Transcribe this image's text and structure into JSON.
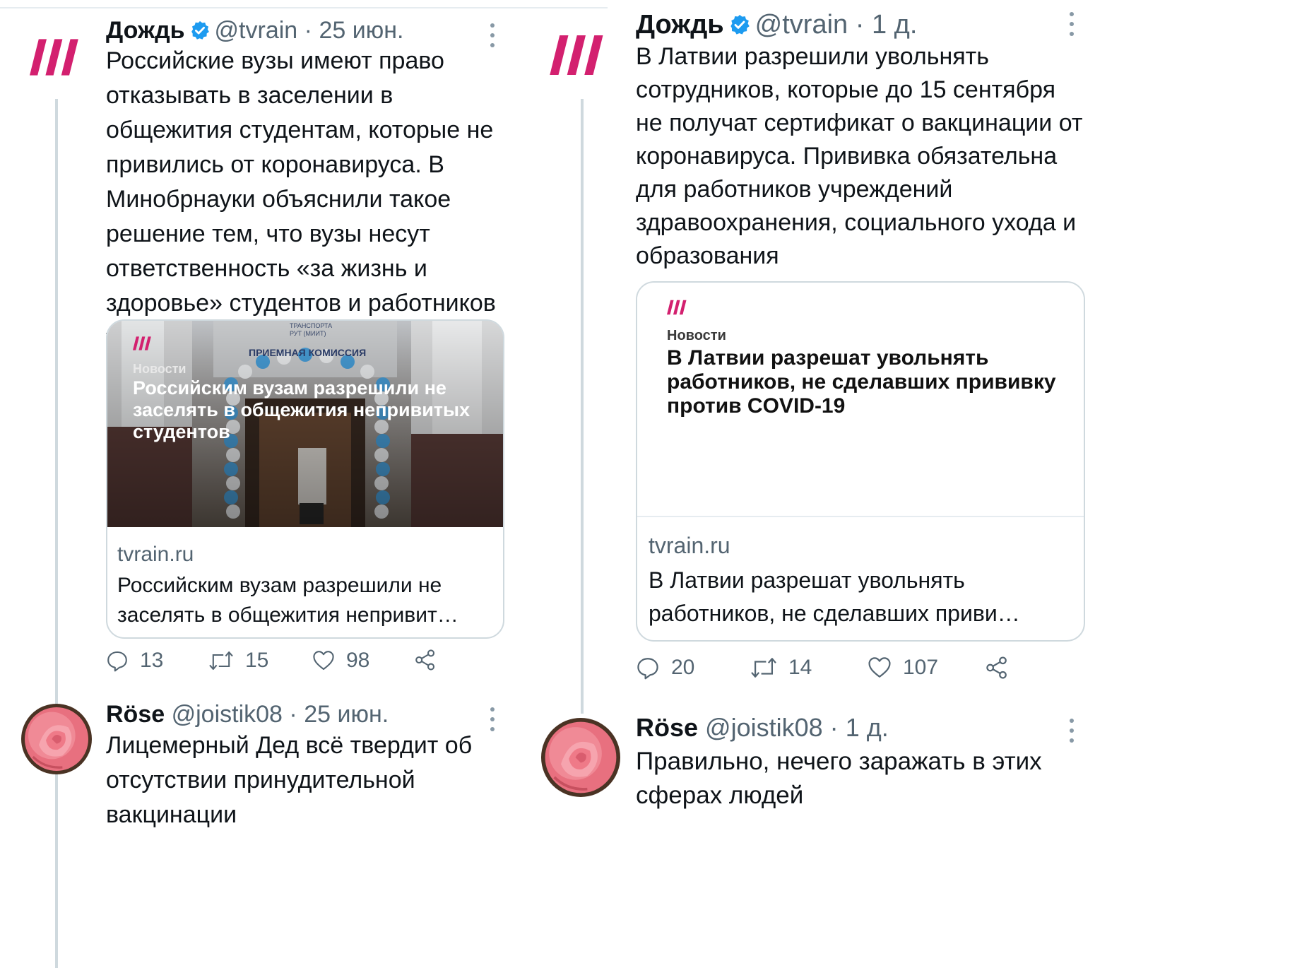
{
  "colors": {
    "brand": "#d3206f",
    "verified": "#1d9bf0",
    "muted": "#536471",
    "text": "#0f1419",
    "border": "#cfd9de"
  },
  "left": {
    "tweet": {
      "name": "Дождь",
      "handle": "@tvrain",
      "sep": "·",
      "date": "25 июн.",
      "text": "Российские вузы имеют право отказывать в заселении в общежития студентам, которые не привились от коронавируса. В Минобрнауки объяснили такое решение тем, что вузы несут ответственность «за жизнь и здоровье» студентов и работников учреждения",
      "card": {
        "media_label": "Новости",
        "media_title": "Российским вузам разрешили не заселять в общежития непривитых студентов",
        "sign_line1": "ТРАНСПОРТА",
        "sign_line2": "РУТ (МИИТ)",
        "sign_main": "ПРИЕМНАЯ КОМИССИЯ",
        "domain": "tvrain.ru",
        "title": "Российским вузам разрешили не заселять в общежития непривит…"
      },
      "replies": "13",
      "retweets": "15",
      "likes": "98"
    },
    "reply": {
      "name": "Röse",
      "handle": "@joistik08",
      "sep": "·",
      "date": "25 июн.",
      "text": "Лицемерный Дед всё твердит об отсутствии принудительной вакцинации"
    }
  },
  "right": {
    "tweet": {
      "name": "Дождь",
      "handle": "@tvrain",
      "sep": "·",
      "date": "1 д.",
      "text": "В Латвии разрешили увольнять сотрудников, которые до 15 сентября не получат сертификат о вакцинации от коронавируса. Прививка обязательна для работников учреждений здравоохранения, социального ухода и образования",
      "card": {
        "media_label": "Новости",
        "media_title": "В Латвии разрешат увольнять работников, не сделавших прививку против COVID-19",
        "domain": "tvrain.ru",
        "title": "В Латвии разрешат увольнять работников, не сделавших приви…"
      },
      "replies": "20",
      "retweets": "14",
      "likes": "107"
    },
    "reply": {
      "name": "Röse",
      "handle": "@joistik08",
      "sep": "·",
      "date": "1 д.",
      "text": "Правильно, нечего заражать в этих сферах людей"
    }
  }
}
